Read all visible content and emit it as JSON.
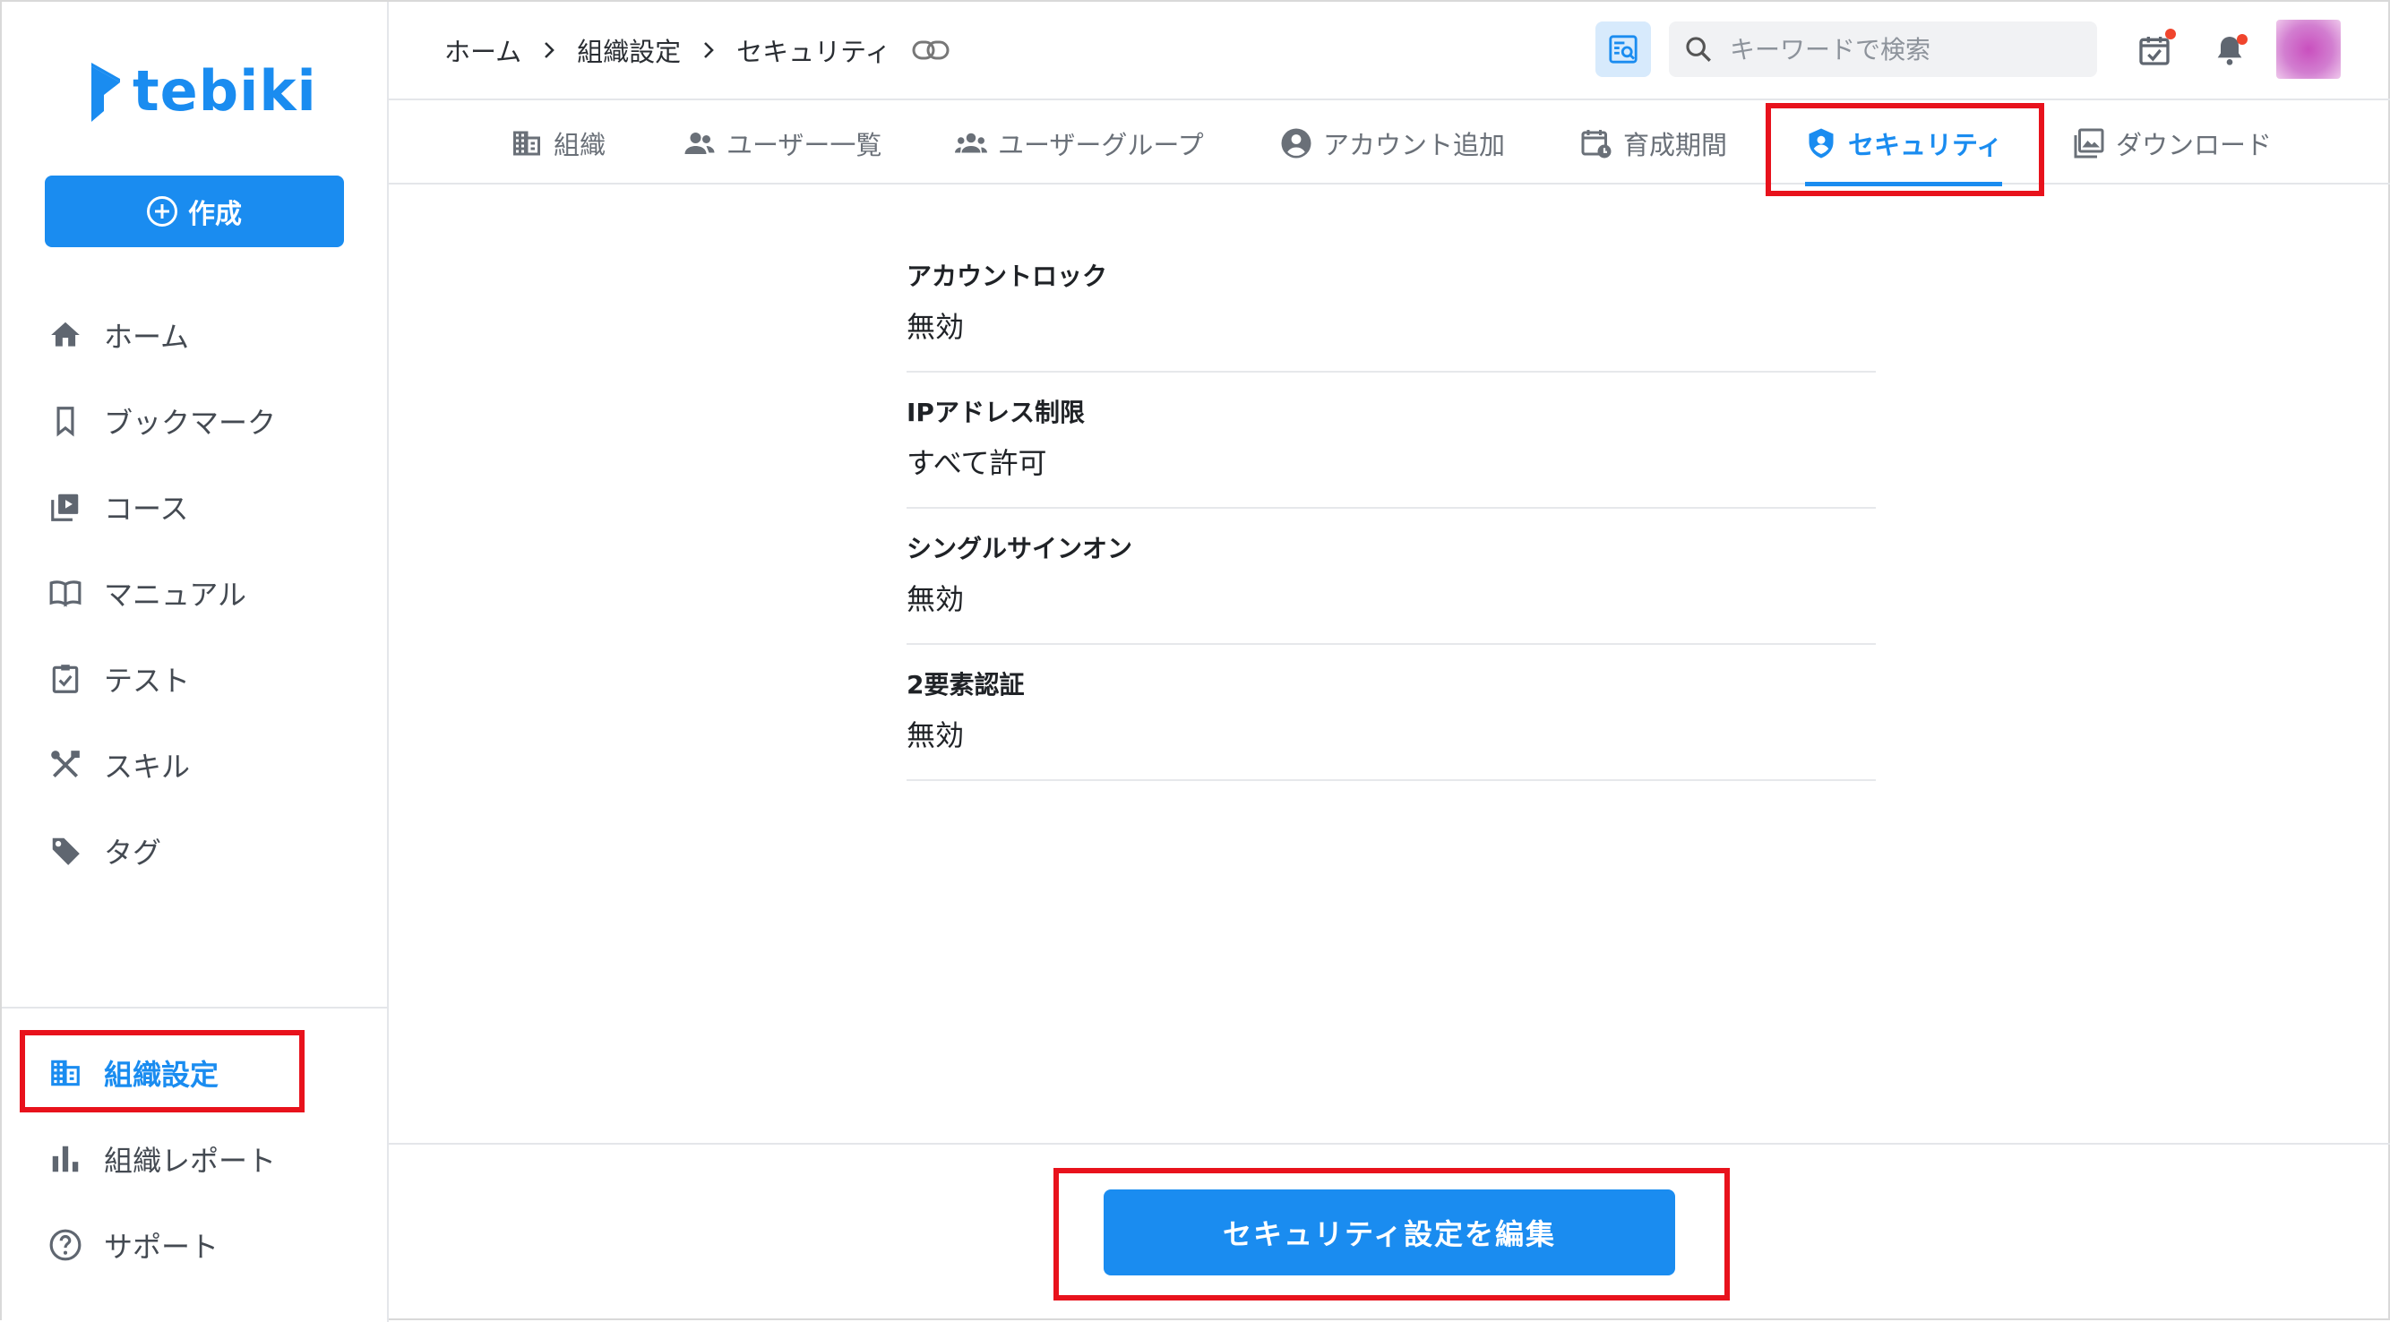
{
  "brand": {
    "name": "tebiki",
    "color": "#1a8cf0"
  },
  "sidebar": {
    "create_label": "作成",
    "items": [
      {
        "label": "ホーム",
        "icon": "home-icon"
      },
      {
        "label": "ブックマーク",
        "icon": "bookmark-icon"
      },
      {
        "label": "コース",
        "icon": "course-icon"
      },
      {
        "label": "マニュアル",
        "icon": "book-icon"
      },
      {
        "label": "テスト",
        "icon": "clipboard-check-icon"
      },
      {
        "label": "スキル",
        "icon": "tools-icon"
      },
      {
        "label": "タグ",
        "icon": "tag-icon"
      }
    ],
    "bottom_items": [
      {
        "label": "組織設定",
        "icon": "building-icon",
        "active": true
      },
      {
        "label": "組織レポート",
        "icon": "bar-chart-icon"
      },
      {
        "label": "サポート",
        "icon": "help-icon"
      }
    ]
  },
  "header": {
    "breadcrumb": [
      "ホーム",
      "組織設定",
      "セキュリティ"
    ],
    "search_placeholder": "キーワードで検索"
  },
  "tabs": [
    {
      "label": "組織",
      "icon": "building-icon"
    },
    {
      "label": "ユーザー一覧",
      "icon": "users-icon"
    },
    {
      "label": "ユーザーグループ",
      "icon": "group-icon"
    },
    {
      "label": "アカウント追加",
      "icon": "account-circle-icon"
    },
    {
      "label": "育成期間",
      "icon": "calendar-clock-icon"
    },
    {
      "label": "セキュリティ",
      "icon": "shield-user-icon",
      "active": true
    },
    {
      "label": "ダウンロード",
      "icon": "photo-library-icon"
    }
  ],
  "settings": [
    {
      "label": "アカウントロック",
      "value": "無効"
    },
    {
      "label": "IPアドレス制限",
      "value": "すべて許可"
    },
    {
      "label": "シングルサインオン",
      "value": "無効"
    },
    {
      "label": "2要素認証",
      "value": "無効"
    }
  ],
  "footer": {
    "edit_label": "セキュリティ設定を編集"
  },
  "colors": {
    "accent": "#1a8cf0",
    "highlight": "#e8121c",
    "notification_dot": "#f0452d"
  }
}
